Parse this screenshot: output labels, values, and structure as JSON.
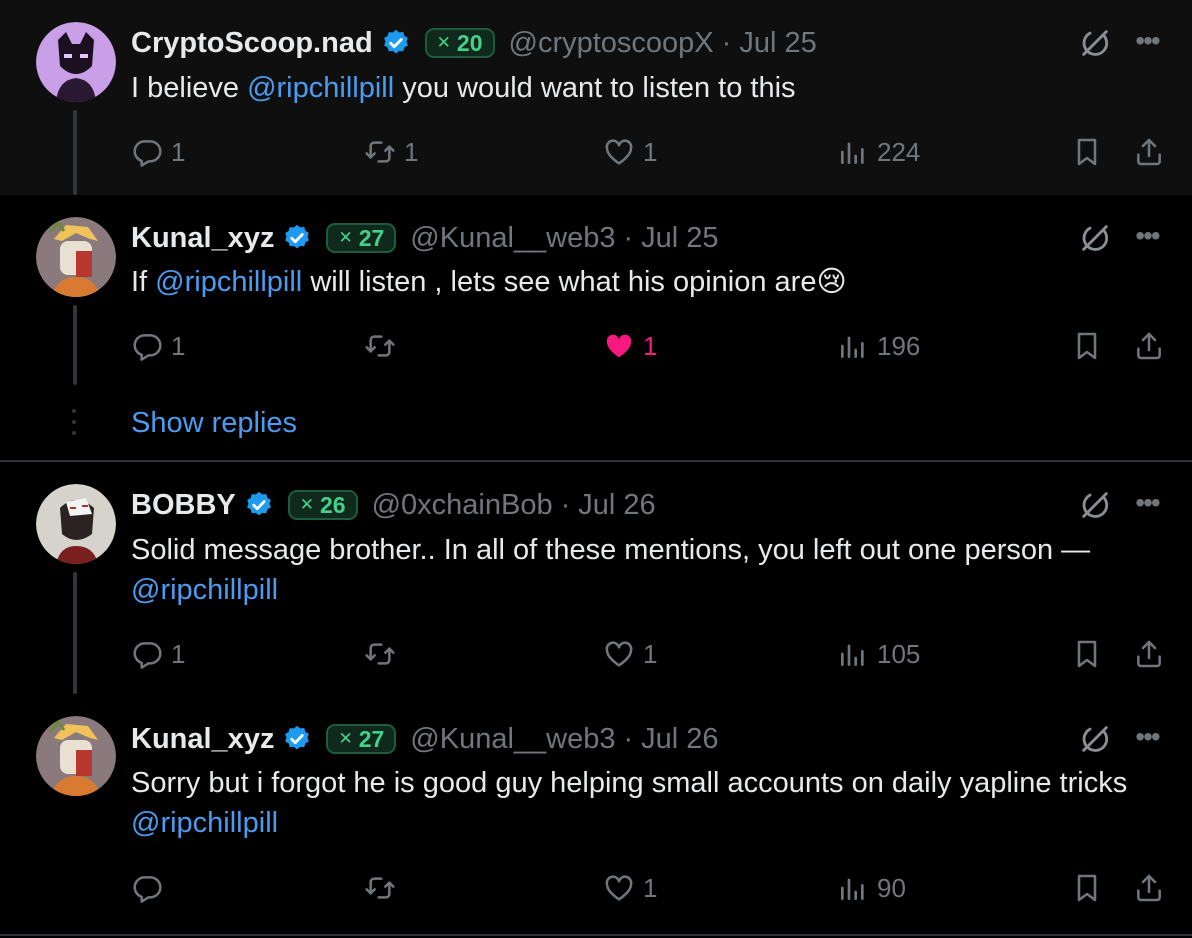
{
  "tweets": [
    {
      "name": "CryptoScoop.nad",
      "badge": "20",
      "handle": "@cryptoscoopX",
      "date": "Jul 25",
      "text_parts": [
        "I believe ",
        "@ripchillpill",
        " you would want to listen to this"
      ],
      "replies": "1",
      "reposts": "1",
      "likes": "1",
      "views": "224",
      "liked": false
    },
    {
      "name": "Kunal_xyz",
      "badge": "27",
      "handle": "@Kunal__web3",
      "date": "Jul 25",
      "text_parts": [
        "If ",
        "@ripchillpill",
        " will listen , lets see what his opinion are😢"
      ],
      "replies": "1",
      "reposts": "",
      "likes": "1",
      "views": "196",
      "liked": true
    },
    {
      "name": "BOBBY",
      "badge": "26",
      "handle": "@0xchainBob",
      "date": "Jul 26",
      "text_parts": [
        "Solid message brother.. In all of these mentions, you left out one person — ",
        "@ripchillpill",
        ""
      ],
      "replies": "1",
      "reposts": "",
      "likes": "1",
      "views": "105",
      "liked": false
    },
    {
      "name": "Kunal_xyz",
      "badge": "27",
      "handle": "@Kunal__web3",
      "date": "Jul 26",
      "text_parts": [
        "Sorry but i forgot he is good guy helping small accounts on daily yapline tricks ",
        "@ripchillpill",
        ""
      ],
      "replies": "",
      "reposts": "",
      "likes": "1",
      "views": "90",
      "liked": false
    }
  ],
  "show_replies": "Show replies",
  "separator": "·",
  "icons": {
    "reply": "reply-icon",
    "repost": "repost-icon",
    "like": "heart-icon",
    "views": "views-icon",
    "bookmark": "bookmark-icon",
    "share": "share-icon",
    "grok": "grok-icon",
    "more": "more-icon",
    "verified": "verified-badge-icon"
  },
  "colors": {
    "background": "#000000",
    "text": "#e7e9ea",
    "muted": "#71767b",
    "link": "#4b9cf0",
    "like_active": "#f91880",
    "badge_green": "#46d18b",
    "verified_blue": "#1d9bf0"
  }
}
